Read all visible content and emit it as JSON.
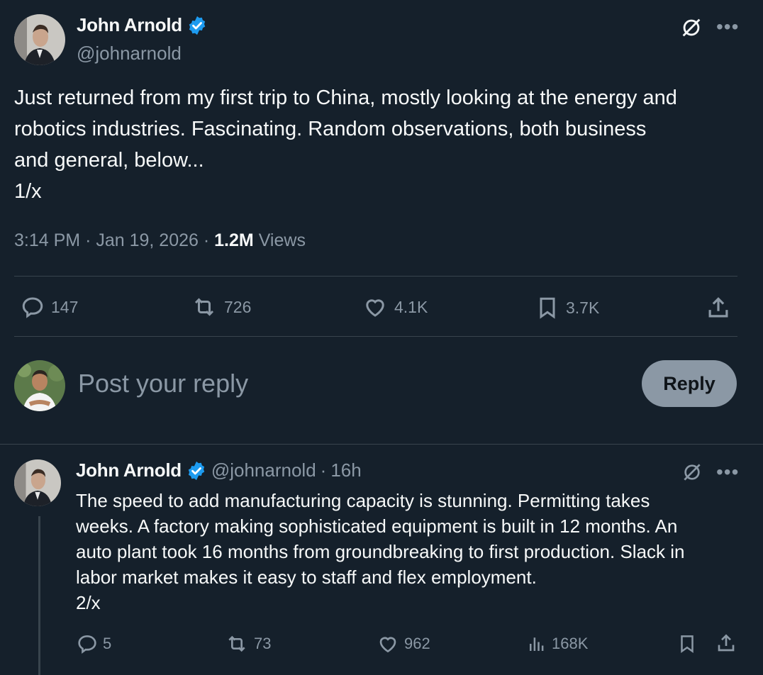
{
  "main_tweet": {
    "author_name": "John Arnold",
    "author_handle": "@johnarnold",
    "text": "Just returned from my first trip to China, mostly looking at the energy and\nrobotics industries. Fascinating. Random observations, both business\nand general, below...\n1/x",
    "time": "3:14 PM",
    "date": "Jan 19, 2026",
    "views_count": "1.2M",
    "views_label": "Views",
    "replies": "147",
    "reposts": "726",
    "likes": "4.1K",
    "bookmarks": "3.7K"
  },
  "composer": {
    "placeholder": "Post your reply",
    "reply_label": "Reply"
  },
  "reply_tweet": {
    "author_name": "John Arnold",
    "author_handle": "@johnarnold",
    "age": "16h",
    "text": "The speed to add manufacturing capacity is stunning. Permitting takes\nweeks. A factory making sophisticated equipment is built in 12 months. An\nauto plant took 16 months from groundbreaking to first production. Slack in\nlabor market makes it easy to staff and flex employment.\n2/x",
    "replies": "5",
    "reposts": "73",
    "likes": "962",
    "views": "168K"
  },
  "colors": {
    "background": "#15202b",
    "verified": "#1d9bf0",
    "muted": "#8b98a5",
    "divider": "#38444d"
  }
}
